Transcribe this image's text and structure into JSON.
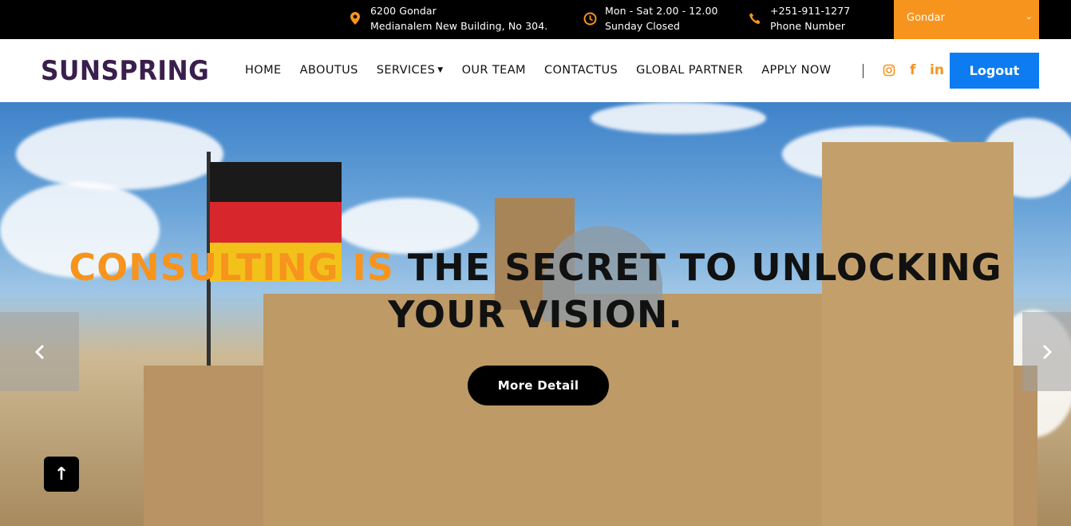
{
  "topbar": {
    "address": {
      "line1": "6200 Gondar",
      "line2": "Medianalem New Building, No 304.",
      "icon": "map-pin-icon"
    },
    "hours": {
      "line1": "Mon - Sat 2.00 - 12.00",
      "line2": "Sunday Closed",
      "icon": "clock-icon"
    },
    "phone": {
      "line1": "+251-911-1277",
      "line2": "Phone Number",
      "icon": "phone-icon"
    },
    "city_select": {
      "value": "Gondar"
    }
  },
  "navbar": {
    "logo": "SUNSPRING",
    "links": [
      "HOME",
      "ABOUTUS",
      "SERVICES",
      "OUR TEAM",
      "CONTACTUS",
      "GLOBAL PARTNER",
      "APPLY NOW"
    ],
    "social": {
      "instagram": "instagram-icon",
      "facebook": "f",
      "linkedin": "in"
    },
    "logout_label": "Logout"
  },
  "hero": {
    "title_accent": "CONSULTING IS",
    "title_rest_line1": "THE SECRET TO UNLOCKING",
    "title_line2": "YOUR VISION.",
    "button_label": "More Detail",
    "prev_arrow": "‹",
    "next_arrow": "›",
    "scroll_top": "↑"
  },
  "colors": {
    "accent": "#f7941d",
    "primary": "#0d7cf2",
    "logo": "#3a1f4d"
  }
}
